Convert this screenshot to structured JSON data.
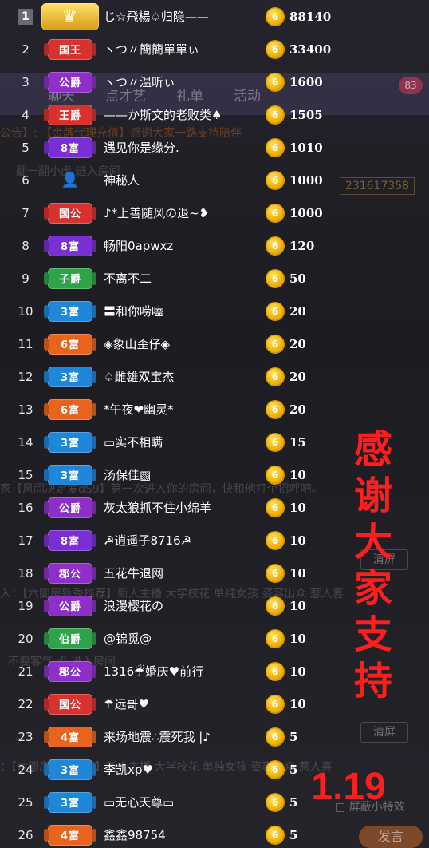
{
  "background": {
    "tabs": [
      "聊天",
      "点才艺",
      "礼单",
      "活动"
    ],
    "tab_badge": "83",
    "room_id": "231617358",
    "chat_lines": [
      "公告】: 【金牌代理充值】感谢大家一路支持陪伴",
      "翻一翻小虎    进入房间",
      "家【风间决定爱dS9】第一次进入你的房间，快和他打个招呼吧。",
      "入：【六間房新秀推荐】新人主播 大学校花 单纯女孩 姿容出众 惹人喜",
      "不要客气 点 进入房间",
      "：【六間房新秀推荐】新人主播 大学校花 单纯女孩 姿容出众 惹人喜"
    ],
    "clear_button": "清屏",
    "special_effects_checkbox": "屏蔽小特效",
    "send_button": "发言"
  },
  "ranking": [
    {
      "rank": "1",
      "badge": "",
      "name": "じ☆飛楊♤归隐——",
      "amount": "88140"
    },
    {
      "rank": "2",
      "badge": "国王",
      "name": "ヽつ〃簡簡單單ぃ",
      "amount": "33400"
    },
    {
      "rank": "3",
      "badge": "公爵",
      "name": "ヽつ〃温昕ぃ",
      "amount": "1600"
    },
    {
      "rank": "4",
      "badge": "王爵",
      "name": "——か斯文的老败类♠",
      "amount": "1505"
    },
    {
      "rank": "5",
      "badge": "8富",
      "name": "遇见你是缘分.",
      "amount": "1010"
    },
    {
      "rank": "6",
      "badge": "",
      "name": "神秘人",
      "amount": "1000"
    },
    {
      "rank": "7",
      "badge": "国公",
      "name": "♪*上善随风の退~❥",
      "amount": "1000"
    },
    {
      "rank": "8",
      "badge": "8富",
      "name": "畅阳0apwxz",
      "amount": "120"
    },
    {
      "rank": "9",
      "badge": "子爵",
      "name": "不离不二",
      "amount": "50"
    },
    {
      "rank": "10",
      "badge": "3富",
      "name": "〓和你唠嗑",
      "amount": "20"
    },
    {
      "rank": "11",
      "badge": "6富",
      "name": "◈象山歪仔◈",
      "amount": "20"
    },
    {
      "rank": "12",
      "badge": "3富",
      "name": "♤雌雄双宝杰",
      "amount": "20"
    },
    {
      "rank": "13",
      "badge": "6富",
      "name": "*午夜❤幽灵*",
      "amount": "20"
    },
    {
      "rank": "14",
      "badge": "3富",
      "name": "▭实不相瞒",
      "amount": "15"
    },
    {
      "rank": "15",
      "badge": "3富",
      "name": "汤保佳▧",
      "amount": "10"
    },
    {
      "rank": "16",
      "badge": "公爵",
      "name": "灰太狼抓不住小绵羊",
      "amount": "10"
    },
    {
      "rank": "17",
      "badge": "8富",
      "name": "☭逍遥子8716☭",
      "amount": "10"
    },
    {
      "rank": "18",
      "badge": "郡公",
      "name": "五花牛退网",
      "amount": "10"
    },
    {
      "rank": "19",
      "badge": "公爵",
      "name": "浪漫樱花の",
      "amount": "10"
    },
    {
      "rank": "20",
      "badge": "伯爵",
      "name": "@锦觅@",
      "amount": "10"
    },
    {
      "rank": "21",
      "badge": "郡公",
      "name": "1316☔婚庆♥前行",
      "amount": "10"
    },
    {
      "rank": "22",
      "badge": "国公",
      "name": "☂远哥♥",
      "amount": "10"
    },
    {
      "rank": "23",
      "badge": "4富",
      "name": "来场地震∴震死我 |♪",
      "amount": "5"
    },
    {
      "rank": "24",
      "badge": "3富",
      "name": "李凯xp♥",
      "amount": "5"
    },
    {
      "rank": "25",
      "badge": "3富",
      "name": "▭无心天尊▭",
      "amount": "5"
    },
    {
      "rank": "26",
      "badge": "4富",
      "name": "鑫鑫98754",
      "amount": "5"
    }
  ],
  "coin_glyph": "6",
  "thanks": {
    "text": [
      "感",
      "谢",
      "大",
      "家",
      "支",
      "持"
    ],
    "date": "1.19",
    "color": "#ff1e1e"
  },
  "badge_colors": {
    "国王": "#d8322f",
    "公爵": "#8e2fc9",
    "王爵": "#d8322f",
    "8富": "#7a2fd6",
    "国公": "#d8322f",
    "子爵": "#2fa34a",
    "3富": "#1f86d8",
    "6富": "#e8641e",
    "郡公": "#8e2fc9",
    "伯爵": "#2fa34a",
    "4富": "#e8641e"
  }
}
